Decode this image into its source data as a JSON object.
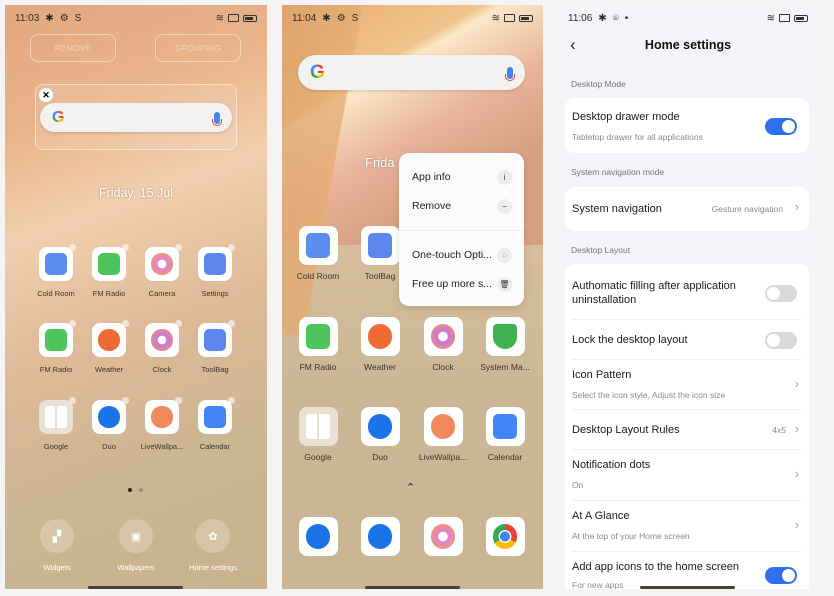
{
  "screen1": {
    "status": {
      "time": "11:03",
      "icons": [
        "bluetooth-icon",
        "gear-icon",
        "s-icon",
        "wifi-icon",
        "cast-icon",
        "battery-icon"
      ]
    },
    "edit_buttons": {
      "remove": "REMOVE",
      "grouping": "GROUPING"
    },
    "date": "Friday, 15 Jul",
    "apps": [
      {
        "label": "Cold Room",
        "icon": "cube-icon",
        "color": "#5b8ef0"
      },
      {
        "label": "FM Radio",
        "icon": "radio-icon",
        "color": "#4cc55a"
      },
      {
        "label": "Camera",
        "icon": "camera-icon",
        "color": "#e37fd2"
      },
      {
        "label": "Settings",
        "icon": "settings-icon",
        "color": "#5b87ee"
      },
      {
        "label": "FM Radio",
        "icon": "radio-icon",
        "color": "#4cc55a"
      },
      {
        "label": "Weather",
        "icon": "weather-icon",
        "color": "#f06a35"
      },
      {
        "label": "Clock",
        "icon": "clock-icon",
        "color": "#c873e0"
      },
      {
        "label": "ToolBag",
        "icon": "toolbag-icon",
        "color": "#5b87ee"
      },
      {
        "label": "Google",
        "icon": "google-folder-icon",
        "color": "#e5ddd0"
      },
      {
        "label": "Duo",
        "icon": "duo-icon",
        "color": "#1a73e8"
      },
      {
        "label": "LiveWallpa...",
        "icon": "paint-roller-icon",
        "color": "#f08a5d"
      },
      {
        "label": "Calendar",
        "icon": "calendar-icon",
        "color": "#4285f4"
      }
    ],
    "actions": [
      {
        "label": "Widgets",
        "icon": "widgets-icon"
      },
      {
        "label": "Wallpapers",
        "icon": "wallpaper-icon"
      },
      {
        "label": "Home settings",
        "icon": "gear-icon"
      }
    ]
  },
  "screen2": {
    "status": {
      "time": "11:04"
    },
    "date_partial": "Frida",
    "popup": {
      "items": [
        {
          "label": "App info",
          "icon": "info-icon"
        },
        {
          "label": "Remove",
          "icon": "minus-circle-icon"
        },
        {
          "label": "One-touch Opti...",
          "icon": "shield-icon"
        },
        {
          "label": "Free up more s...",
          "icon": "trash-icon"
        }
      ]
    },
    "apps": [
      {
        "label": "Cold Room",
        "icon": "cube-icon",
        "color": "#5b8ef0"
      },
      {
        "label": "ToolBag",
        "icon": "toolbag-icon",
        "color": "#5b87ee"
      },
      {
        "label": "FM Radio",
        "icon": "radio-icon",
        "color": "#4cc55a"
      },
      {
        "label": "Weather",
        "icon": "weather-icon",
        "color": "#f06a35"
      },
      {
        "label": "Clock",
        "icon": "clock-icon",
        "color": "#c873e0"
      },
      {
        "label": "System Ma...",
        "icon": "shield-icon",
        "color": "#3fb34f"
      },
      {
        "label": "Google",
        "icon": "google-folder-icon",
        "color": "#e5ddd0"
      },
      {
        "label": "Duo",
        "icon": "duo-icon",
        "color": "#1a73e8"
      },
      {
        "label": "LiveWallpa...",
        "icon": "paint-roller-icon",
        "color": "#f08a5d"
      },
      {
        "label": "Calendar",
        "icon": "calendar-icon",
        "color": "#4285f4"
      }
    ],
    "dock": [
      {
        "icon": "phone-icon",
        "color": "#1a73e8"
      },
      {
        "icon": "messages-icon",
        "color": "#1a73e8"
      },
      {
        "icon": "camera-icon",
        "color": "#e37fd2"
      },
      {
        "icon": "chrome-icon",
        "color": "#4285f4"
      }
    ]
  },
  "screen3": {
    "status": {
      "time": "11:06"
    },
    "title": "Home settings",
    "sections": {
      "desktop_mode": "Desktop Mode",
      "nav_mode": "System navigation mode",
      "layout": "Desktop Layout"
    },
    "drawer": {
      "title": "Desktop drawer mode",
      "subtitle": "Tabletop drawer for all applications",
      "on": true
    },
    "navigation": {
      "title": "System navigation",
      "value": "Gesture navigation"
    },
    "layout_items": [
      {
        "title": "Authomatic filling after application uninstallation",
        "toggle": false
      },
      {
        "title": "Lock the desktop layout",
        "toggle": false
      },
      {
        "title": "Icon Pattern",
        "subtitle": "Select the icon style, Adjust the icon size"
      },
      {
        "title": "Desktop Layout Rules",
        "value": "4x5"
      },
      {
        "title": "Notification dots",
        "subtitle": "On"
      },
      {
        "title": "At A Glance",
        "subtitle": "At the top of your Home screen"
      },
      {
        "title": "Add app icons to the home screen",
        "subtitle": "For new apps",
        "toggle": true
      }
    ],
    "accent": "#2f6ff2"
  }
}
